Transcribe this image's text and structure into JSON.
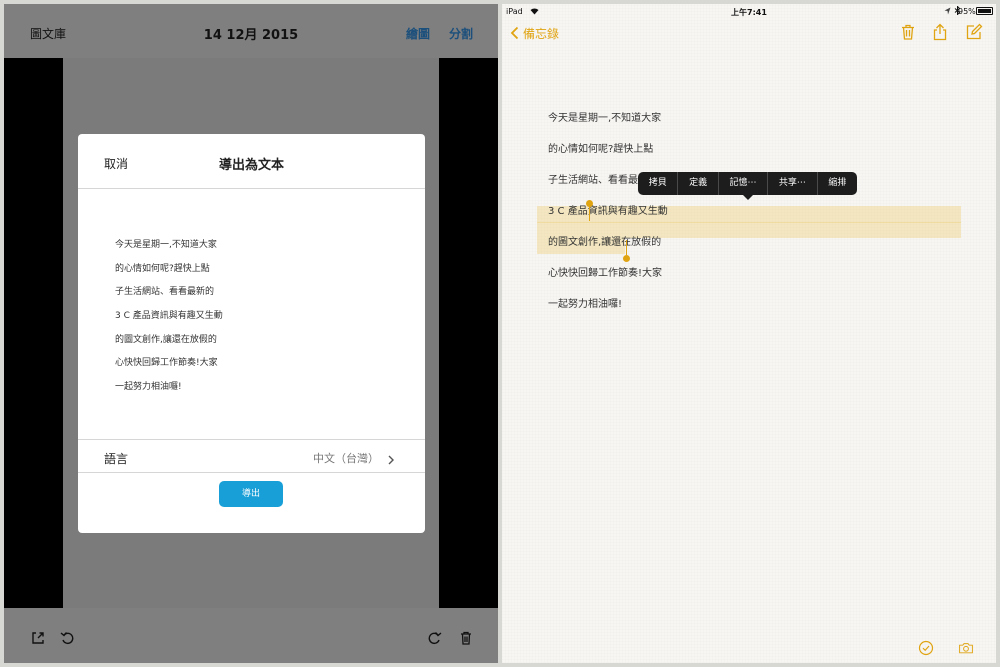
{
  "left": {
    "header": {
      "library": "圖文庫",
      "date": "14 12月 2015",
      "edit": "繪圖",
      "split": "分割"
    },
    "dialog": {
      "cancel": "取消",
      "title": "導出為文本",
      "lines": [
        "今天是星期一,不知道大家",
        "的心情如何呢?趕快上點",
        "子生活網站、看看最新的",
        "3 C 產品資訊與有趣又生動",
        "的圖文創作,讓還在放假的",
        "心快快回歸工作節奏!大家",
        "一起努力相油囉!"
      ],
      "language_label": "語言",
      "language_value": "中文（台灣）",
      "export_button": "導出"
    },
    "footer_icons": [
      "share-icon",
      "rotate-left-icon",
      "rotate-right-icon",
      "trash-icon"
    ]
  },
  "right": {
    "status": {
      "device": "iPad",
      "time": "上午7:41",
      "battery": "95%"
    },
    "nav": {
      "back": "備忘錄"
    },
    "toolbar_icons": [
      "trash-icon",
      "share-icon",
      "compose-icon"
    ],
    "note_lines": [
      "今天是星期一,不知道大家",
      "的心情如何呢?趕快上點",
      "子生活網站、看看最新的",
      "3 C 產品資訊與有趣又生動",
      "的圖文創作,讓還在放假的",
      "心快快回歸工作節奏!大家",
      "一起努力相油囉!"
    ],
    "context_menu": [
      "拷貝",
      "定義",
      "記憶⋯",
      "共享⋯",
      "縮排"
    ],
    "bottom_icons": [
      "checklist-icon",
      "camera-icon"
    ],
    "accent_color": "#e0a412"
  }
}
